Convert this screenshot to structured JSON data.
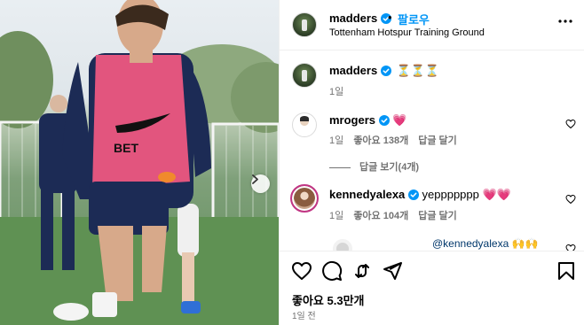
{
  "post": {
    "username": "madders",
    "separator": "•",
    "follow_label": "팔로우",
    "location": "Tottenham Hotspur Training Ground"
  },
  "caption": {
    "username": "madders",
    "text": "⏳⏳⏳",
    "time": "1일"
  },
  "comments": [
    {
      "username": "mrogers",
      "text": "💗",
      "time": "1일",
      "likes": "좋아요 138개",
      "reply_label": "답글 달기"
    },
    {
      "username": "kennedyalexa",
      "text": "yeppppppp 💗💗",
      "time": "1일",
      "likes": "좋아요 104개",
      "reply_label": "답글 달기"
    }
  ],
  "view_replies": "답글 보기(4개)",
  "reply_preview": "@kennedyalexa 🙌🙌",
  "footer": {
    "likes": "좋아요 5.3만개",
    "date": "1일 전"
  },
  "colors": {
    "accent": "#0095f6",
    "verified": "#0095f6",
    "muted": "#737373",
    "bib": "#e2557e"
  },
  "icons": [
    "verified-badge-icon",
    "more-options-icon",
    "heart-icon",
    "comment-icon",
    "share-icon",
    "send-icon",
    "save-icon",
    "chevron-right-icon"
  ]
}
